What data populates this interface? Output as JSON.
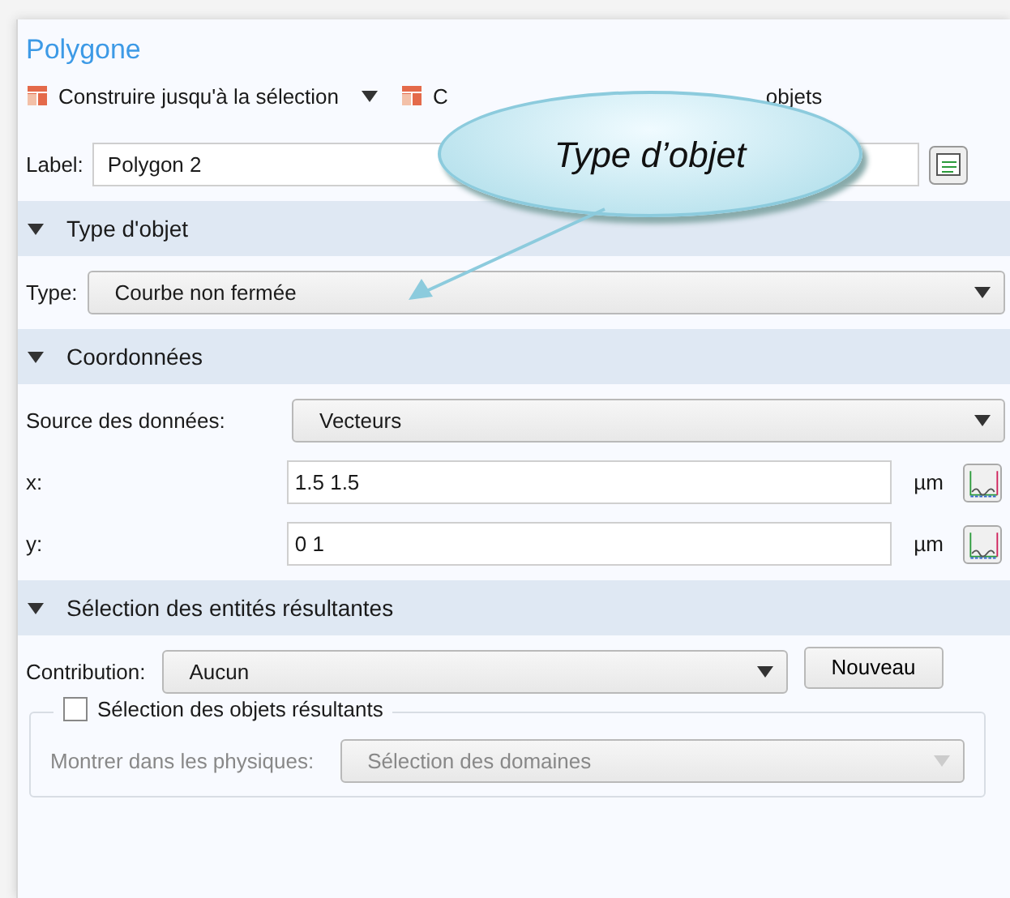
{
  "panel": {
    "title": "Polygone"
  },
  "toolbar": [
    {
      "label_start": "Construire jusqu'à la sélection",
      "dropdown": true
    },
    {
      "label_start": "C",
      "label_end": "objets",
      "dropdown": false
    }
  ],
  "label_field": {
    "label": "Label:",
    "value": "Polygon 2"
  },
  "callout": {
    "text": "Type d’objet"
  },
  "sections": [
    {
      "title": "Type d'objet",
      "expanded": true,
      "rows": [
        {
          "kind": "select",
          "label": "Type:",
          "value": "Courbe non fermée"
        }
      ]
    },
    {
      "title": "Coordonnées",
      "expanded": true,
      "rows": [
        {
          "kind": "select",
          "label": "Source des données:",
          "value": "Vecteurs"
        },
        {
          "kind": "input",
          "label": "x:",
          "value": "1.5 1.5",
          "unit": "µm"
        },
        {
          "kind": "input",
          "label": "y:",
          "value": "0 1",
          "unit": "µm"
        }
      ]
    },
    {
      "title": "Sélection des entités résultantes",
      "expanded": true,
      "rows": [
        {
          "kind": "select_button",
          "label": "Contribution:",
          "value": "Aucun",
          "button": "Nouveau"
        },
        {
          "kind": "group",
          "checkbox_label": "Sélection des objets résultants",
          "checked": false,
          "label": "Montrer dans les physiques:",
          "value": "Sélection des domaines",
          "disabled": true
        }
      ]
    }
  ]
}
